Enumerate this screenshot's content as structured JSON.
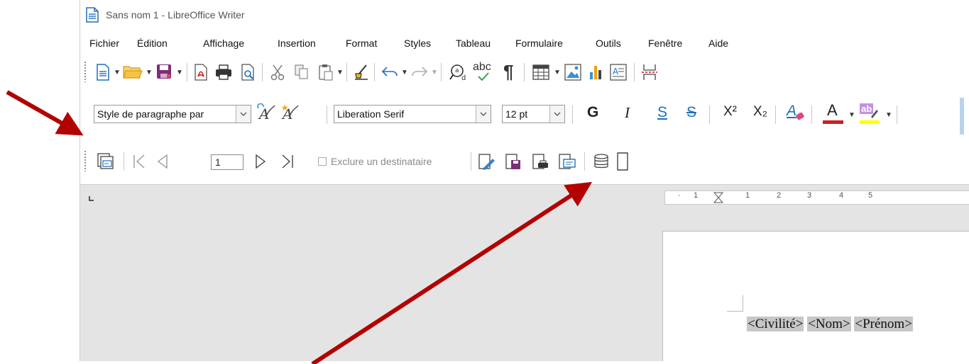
{
  "window": {
    "title": "Sans nom 1 - LibreOffice Writer"
  },
  "menu": {
    "items": [
      "Fichier",
      "Édition",
      "Affichage",
      "Insertion",
      "Format",
      "Styles",
      "Tableau",
      "Formulaire",
      "Outils",
      "Fenêtre",
      "Aide"
    ]
  },
  "standard_toolbar": {
    "icons": [
      "new-document-icon",
      "open-folder-icon",
      "save-icon",
      "export-pdf-icon",
      "print-icon",
      "print-preview-icon",
      "cut-icon",
      "copy-icon",
      "paste-icon",
      "clone-formatting-icon",
      "undo-icon",
      "redo-icon",
      "find-replace-icon",
      "spellcheck-icon",
      "formatting-marks-icon",
      "insert-table-icon",
      "insert-image-icon",
      "insert-chart-icon",
      "insert-textbox-icon",
      "page-break-icon"
    ],
    "spellcheck_label": "abc",
    "formatting_mark": "¶"
  },
  "formatting_toolbar": {
    "paragraph_style": "Style de paragraphe par",
    "font_name": "Liberation Serif",
    "font_size": "12 pt",
    "bold": "G",
    "italic": "I",
    "underline": "S",
    "strikethrough": "S",
    "superscript": "X²",
    "subscript": "X₂",
    "clear_format": "A",
    "font_color": "A",
    "highlight": "ab",
    "font_color_hex": "#c9211e",
    "highlight_hex": "#ffff00"
  },
  "mail_merge_toolbar": {
    "record_number": "1",
    "exclude_label": "Exclure un destinataire",
    "exclude_checked": false
  },
  "ruler": {
    "numbers": [
      "1",
      "1",
      "2",
      "3",
      "4",
      "5"
    ]
  },
  "document": {
    "fields": [
      "<Civilité>",
      "<Nom>",
      "<Prénom>"
    ]
  },
  "annotations": {
    "arrow_color": "#b30000"
  }
}
